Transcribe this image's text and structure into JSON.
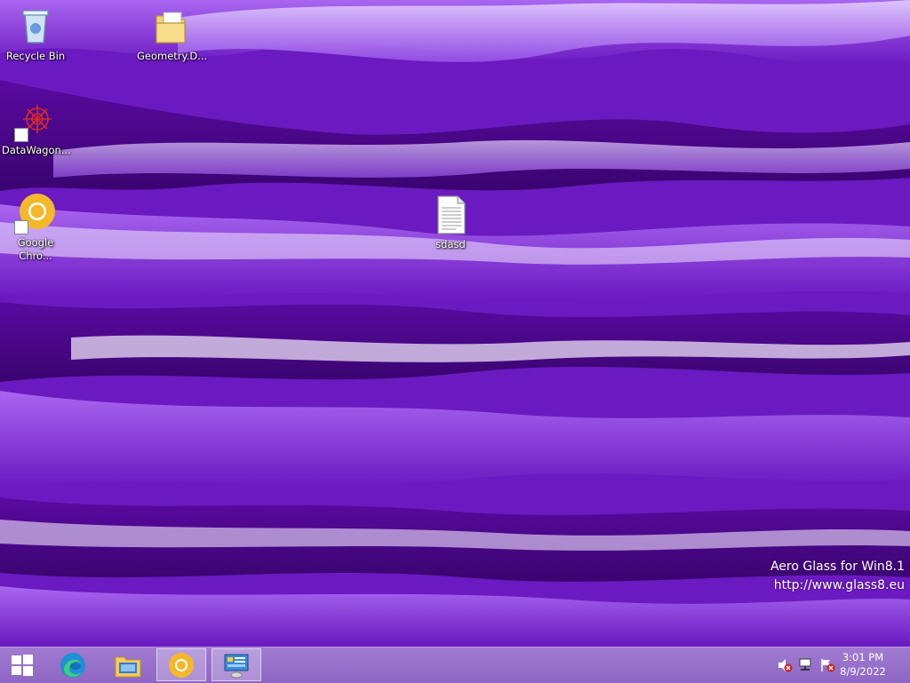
{
  "desktop": {
    "icons": [
      {
        "label": "Recycle Bin"
      },
      {
        "label": "Geometry.D..."
      },
      {
        "label": "DataWagon..."
      },
      {
        "label": "Google Chro..."
      },
      {
        "label": "sdasd"
      }
    ]
  },
  "watermark": {
    "line1": "Aero Glass for Win8.1",
    "line2": "http://www.glass8.eu"
  },
  "taskbar": {
    "buttons": [
      {
        "icon": "windows-logo-icon"
      },
      {
        "icon": "edge-icon"
      },
      {
        "icon": "file-explorer-icon"
      },
      {
        "icon": "chrome-canary-icon",
        "active": true
      },
      {
        "icon": "control-panel-icon",
        "active": true
      }
    ],
    "tray": [
      "volume-muted-icon",
      "network-icon",
      "action-center-flag-icon"
    ],
    "clock": {
      "time": "3:01 PM",
      "date": "8/9/2022"
    }
  },
  "colors": {
    "wallpaper_dark": "#4a0888",
    "wallpaper_mid": "#8a3ee0",
    "taskbar": "#9a74cc"
  }
}
